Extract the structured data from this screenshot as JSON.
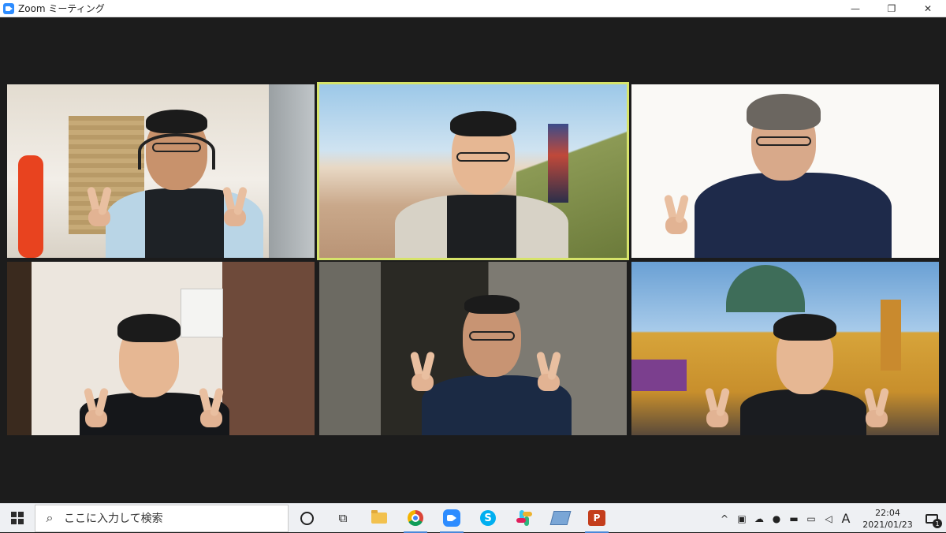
{
  "window": {
    "title": "Zoom ミーティング",
    "minimize": "—",
    "restore": "❐",
    "close": "✕"
  },
  "gallery": {
    "active_speaker_index": 1,
    "participants": [
      {
        "background": "living room",
        "gesture": "peace-sign"
      },
      {
        "background": "beach virtual background",
        "gesture": "smile"
      },
      {
        "background": "white background",
        "gesture": "peace-sign"
      },
      {
        "background": "bedroom",
        "gesture": "peace-sign"
      },
      {
        "background": "dim room",
        "gesture": "peace-sign"
      },
      {
        "background": "Flinders Street Station virtual background",
        "gesture": "peace-sign"
      }
    ],
    "highlight_color": "#d6e36a"
  },
  "taskbar": {
    "search_placeholder": "ここに入力して検索",
    "apps": [
      "cortana-icon",
      "task-view-icon",
      "file-explorer-icon",
      "chrome-icon",
      "zoom-icon",
      "skype-icon",
      "slack-icon",
      "notepad-icon",
      "powerpoint-icon"
    ],
    "skype_letter": "S",
    "ppt_letter": "P",
    "tray": {
      "chevron": "^",
      "ime": "A",
      "time": "22:04",
      "date": "2021/01/23",
      "notification_count": "1"
    }
  }
}
